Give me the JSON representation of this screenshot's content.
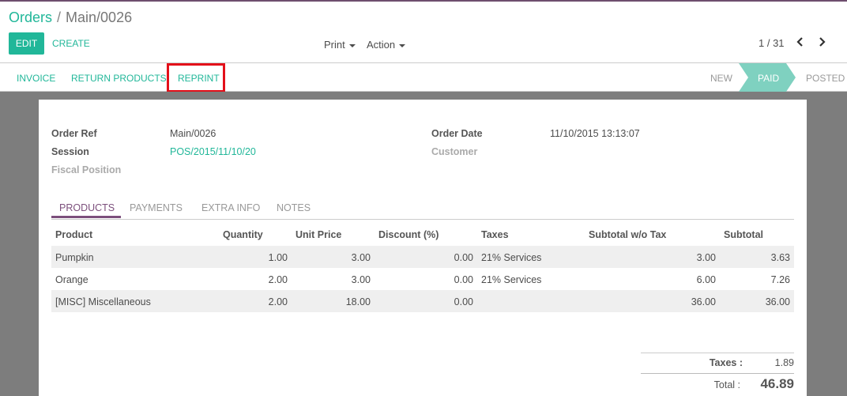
{
  "breadcrumb": {
    "parent": "Orders",
    "separator": "/",
    "current": "Main/0026"
  },
  "toolbar": {
    "edit_label": "EDIT",
    "create_label": "CREATE",
    "print_label": "Print",
    "action_label": "Action"
  },
  "pager": {
    "value": "1 / 31",
    "prev_icon": "chevron-left-icon",
    "next_icon": "chevron-right-icon"
  },
  "header_buttons": {
    "invoice": "INVOICE",
    "return_products": "RETURN PRODUCTS",
    "reprint": "REPRINT"
  },
  "statusbar": {
    "new": "NEW",
    "paid": "PAID",
    "posted": "POSTED",
    "active": "PAID"
  },
  "form": {
    "order_ref_label": "Order Ref",
    "order_ref": "Main/0026",
    "session_label": "Session",
    "session": "POS/2015/11/10/20",
    "fiscal_position_label": "Fiscal Position",
    "order_date_label": "Order Date",
    "order_date": "11/10/2015 13:13:07",
    "customer_label": "Customer"
  },
  "tabs": [
    "PRODUCTS",
    "PAYMENTS",
    "EXTRA INFO",
    "NOTES"
  ],
  "table": {
    "headers": [
      "Product",
      "Quantity",
      "Unit Price",
      "Discount (%)",
      "Taxes",
      "Subtotal w/o Tax",
      "Subtotal"
    ],
    "rows": [
      [
        "Pumpkin",
        "1.00",
        "3.00",
        "0.00",
        "21% Services",
        "3.00",
        "3.63"
      ],
      [
        "Orange",
        "2.00",
        "3.00",
        "0.00",
        "21% Services",
        "6.00",
        "7.26"
      ],
      [
        "[MISC] Miscellaneous",
        "2.00",
        "18.00",
        "0.00",
        "",
        "36.00",
        "36.00"
      ]
    ]
  },
  "totals": {
    "taxes_label": "Taxes :",
    "taxes": "1.89",
    "total_label": "Total :",
    "total": "46.89"
  },
  "colors": {
    "accent": "#21b799",
    "tab_active": "#7c4f7c",
    "highlight_box": "#e3101a"
  }
}
